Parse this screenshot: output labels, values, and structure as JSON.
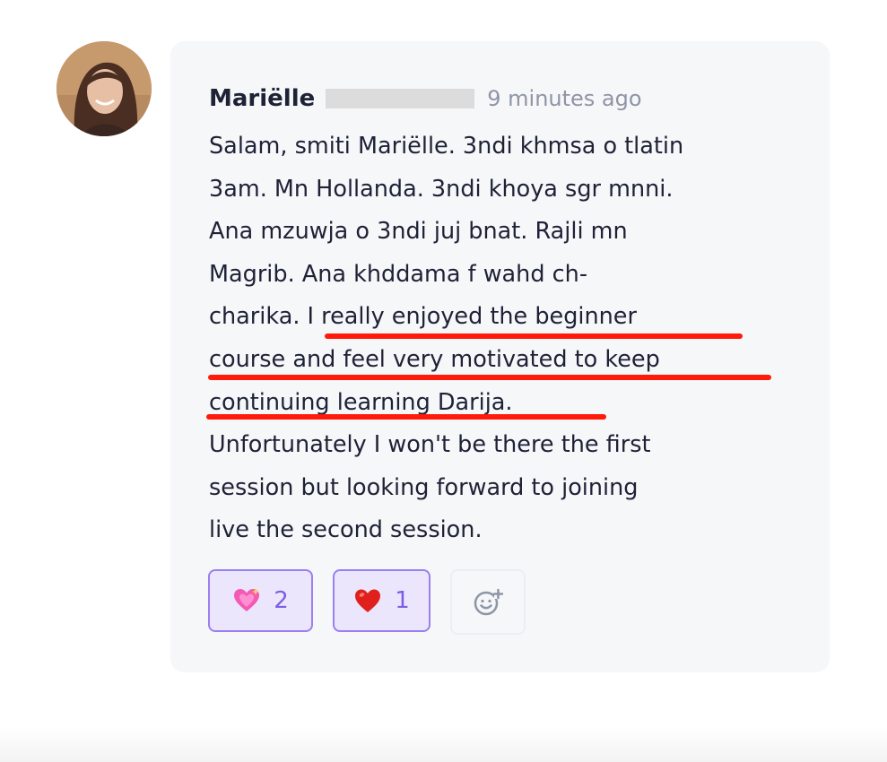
{
  "comment": {
    "author_first_name": "Mariëlle",
    "author_surname_redacted": true,
    "timestamp": "9 minutes ago",
    "message_lines": [
      "Salam, smiti Mariëlle. 3ndi khmsa o tlatin",
      "3am. Mn Hollanda. 3ndi khoya sgr mnni.",
      "Ana mzuwja o 3ndi juj bnat. Rajli mn",
      "Magrib. Ana khddama f wahd ch-"
    ],
    "message_line5_plain": "charika. ",
    "highlighted_lines": [
      "I really enjoyed the beginner",
      "course and feel very motivated to keep",
      "continuing learning Darija."
    ],
    "message_tail_lines": [
      "Unfortunately I won't be there the first",
      "session but looking forward to joining",
      "live the second session."
    ],
    "annotation": "red-underline-highlight",
    "annotation_color": "#ff1a0a"
  },
  "reactions": [
    {
      "icon": "sparkling-heart-icon",
      "count": "2"
    },
    {
      "icon": "red-heart-icon",
      "count": "1"
    }
  ],
  "add_reaction_icon": "add-emoji-icon",
  "colors": {
    "card_background": "#f6f7f9",
    "text": "#1e2236",
    "muted_text": "#8f95a6",
    "reaction_border": "#9b7ff0",
    "reaction_background": "#ece6fd",
    "reaction_count": "#7a5ee6"
  }
}
